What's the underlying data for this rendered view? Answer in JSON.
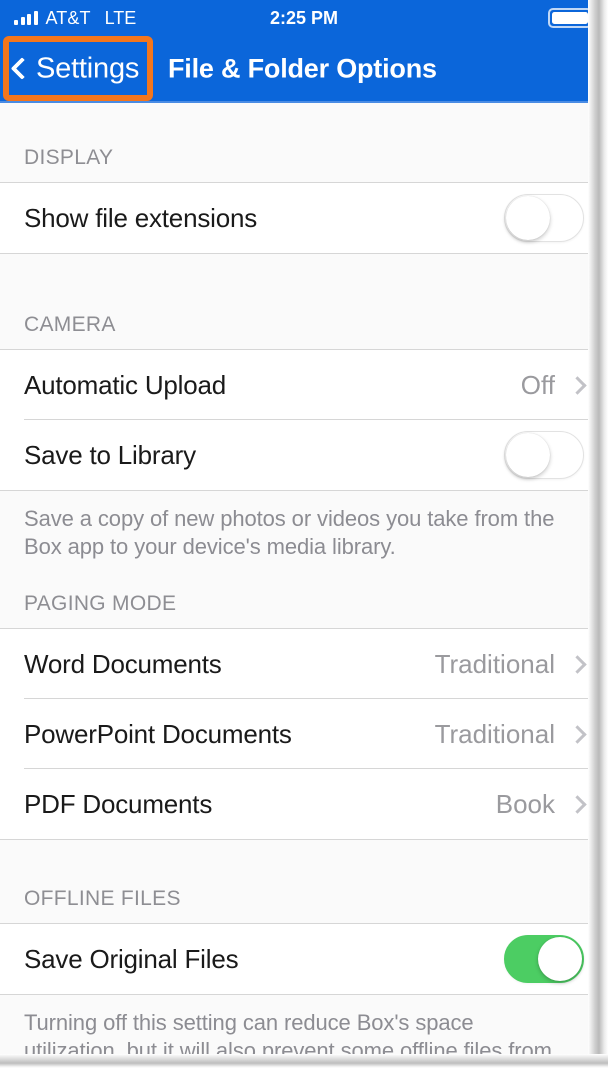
{
  "status_bar": {
    "carrier": "AT&T",
    "network": "LTE",
    "time": "2:25 PM",
    "signal_bars": 4,
    "battery_full": true
  },
  "nav": {
    "back_label": "Settings",
    "title": "File & Folder Options",
    "bar_color": "#0b66da",
    "highlight_color": "#f4761c"
  },
  "sections": {
    "display": {
      "header": "DISPLAY",
      "row_show_extensions": {
        "title": "Show file extensions",
        "toggle": "off"
      }
    },
    "camera": {
      "header": "CAMERA",
      "row_auto_upload": {
        "title": "Automatic Upload",
        "value": "Off"
      },
      "row_save_library": {
        "title": "Save to Library",
        "toggle": "off"
      },
      "note": "Save a copy of new photos or videos you take from the Box app to your device's media library."
    },
    "paging": {
      "header": "PAGING MODE",
      "row_word": {
        "title": "Word Documents",
        "value": "Traditional"
      },
      "row_powerpoint": {
        "title": "PowerPoint Documents",
        "value": "Traditional"
      },
      "row_pdf": {
        "title": "PDF Documents",
        "value": "Book"
      }
    },
    "offline": {
      "header": "OFFLINE FILES",
      "row_save_original": {
        "title": "Save Original Files",
        "toggle": "on"
      },
      "note": "Turning off this setting can reduce Box's space utilization, but it will also prevent some offline files from"
    }
  },
  "colors": {
    "toggle_on": "#4ccd63",
    "accent_blue": "#0b66da",
    "muted_text": "#8e8e93"
  }
}
